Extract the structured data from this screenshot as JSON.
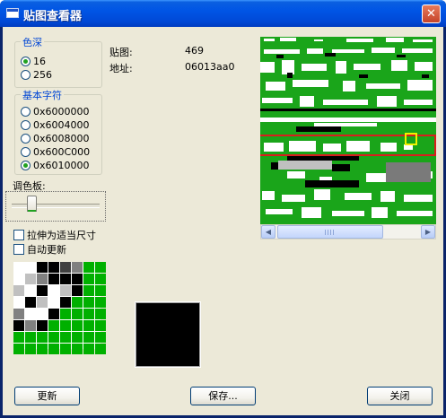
{
  "window": {
    "title": "贴图查看器",
    "close_glyph": "✕"
  },
  "depth": {
    "label": "色深",
    "options": [
      {
        "label": "16",
        "checked": true
      },
      {
        "label": "256",
        "checked": false
      }
    ]
  },
  "base_chars": {
    "label": "基本字符",
    "options": [
      {
        "label": "0x6000000",
        "checked": false
      },
      {
        "label": "0x6004000",
        "checked": false
      },
      {
        "label": "0x6008000",
        "checked": false
      },
      {
        "label": "0x600C000",
        "checked": false
      },
      {
        "label": "0x6010000",
        "checked": true
      }
    ]
  },
  "info": {
    "tile_label": "贴图:",
    "tile_value": "469",
    "address_label": "地址:",
    "address_value": "06013aa0"
  },
  "palette": {
    "label": "调色板:",
    "slider_value": 0.2
  },
  "options": {
    "stretch_label": "拉伸为适当尺寸",
    "stretch_checked": false,
    "auto_update_label": "自动更新",
    "auto_update_checked": false
  },
  "tile_grid_colors": [
    [
      "#ffffff",
      "#ffffff",
      "#000000",
      "#000000",
      "#404040",
      "#808080",
      "#00b000",
      "#00b000"
    ],
    [
      "#ffffff",
      "#c0c0c0",
      "#808080",
      "#000000",
      "#000000",
      "#000000",
      "#00b000",
      "#00b000"
    ],
    [
      "#c0c0c0",
      "#ffffff",
      "#000000",
      "#ffffff",
      "#c0c0c0",
      "#000000",
      "#00b000",
      "#00b000"
    ],
    [
      "#ffffff",
      "#000000",
      "#c0c0c0",
      "#ffffff",
      "#000000",
      "#00b000",
      "#00b000",
      "#00b000"
    ],
    [
      "#808080",
      "#ffffff",
      "#ffffff",
      "#000000",
      "#00b000",
      "#00b000",
      "#00b000",
      "#00b000"
    ],
    [
      "#000000",
      "#808080",
      "#000000",
      "#00b000",
      "#00b000",
      "#00b000",
      "#00b000",
      "#00b000"
    ],
    [
      "#00b000",
      "#00b000",
      "#00b000",
      "#00b000",
      "#00b000",
      "#00b000",
      "#00b000",
      "#00b000"
    ],
    [
      "#00b000",
      "#00b000",
      "#00b000",
      "#00b000",
      "#00b000",
      "#00b000",
      "#00b000",
      "#00b000"
    ]
  ],
  "buttons": {
    "refresh": "更新",
    "save": "保存...",
    "close": "关闭"
  },
  "scrollbar": {
    "left_glyph": "◀",
    "right_glyph": "▶"
  },
  "colors": {
    "tile_bg": "#1aa51a",
    "selection_box": "#d81e1e",
    "highlight": "#f0f000"
  }
}
